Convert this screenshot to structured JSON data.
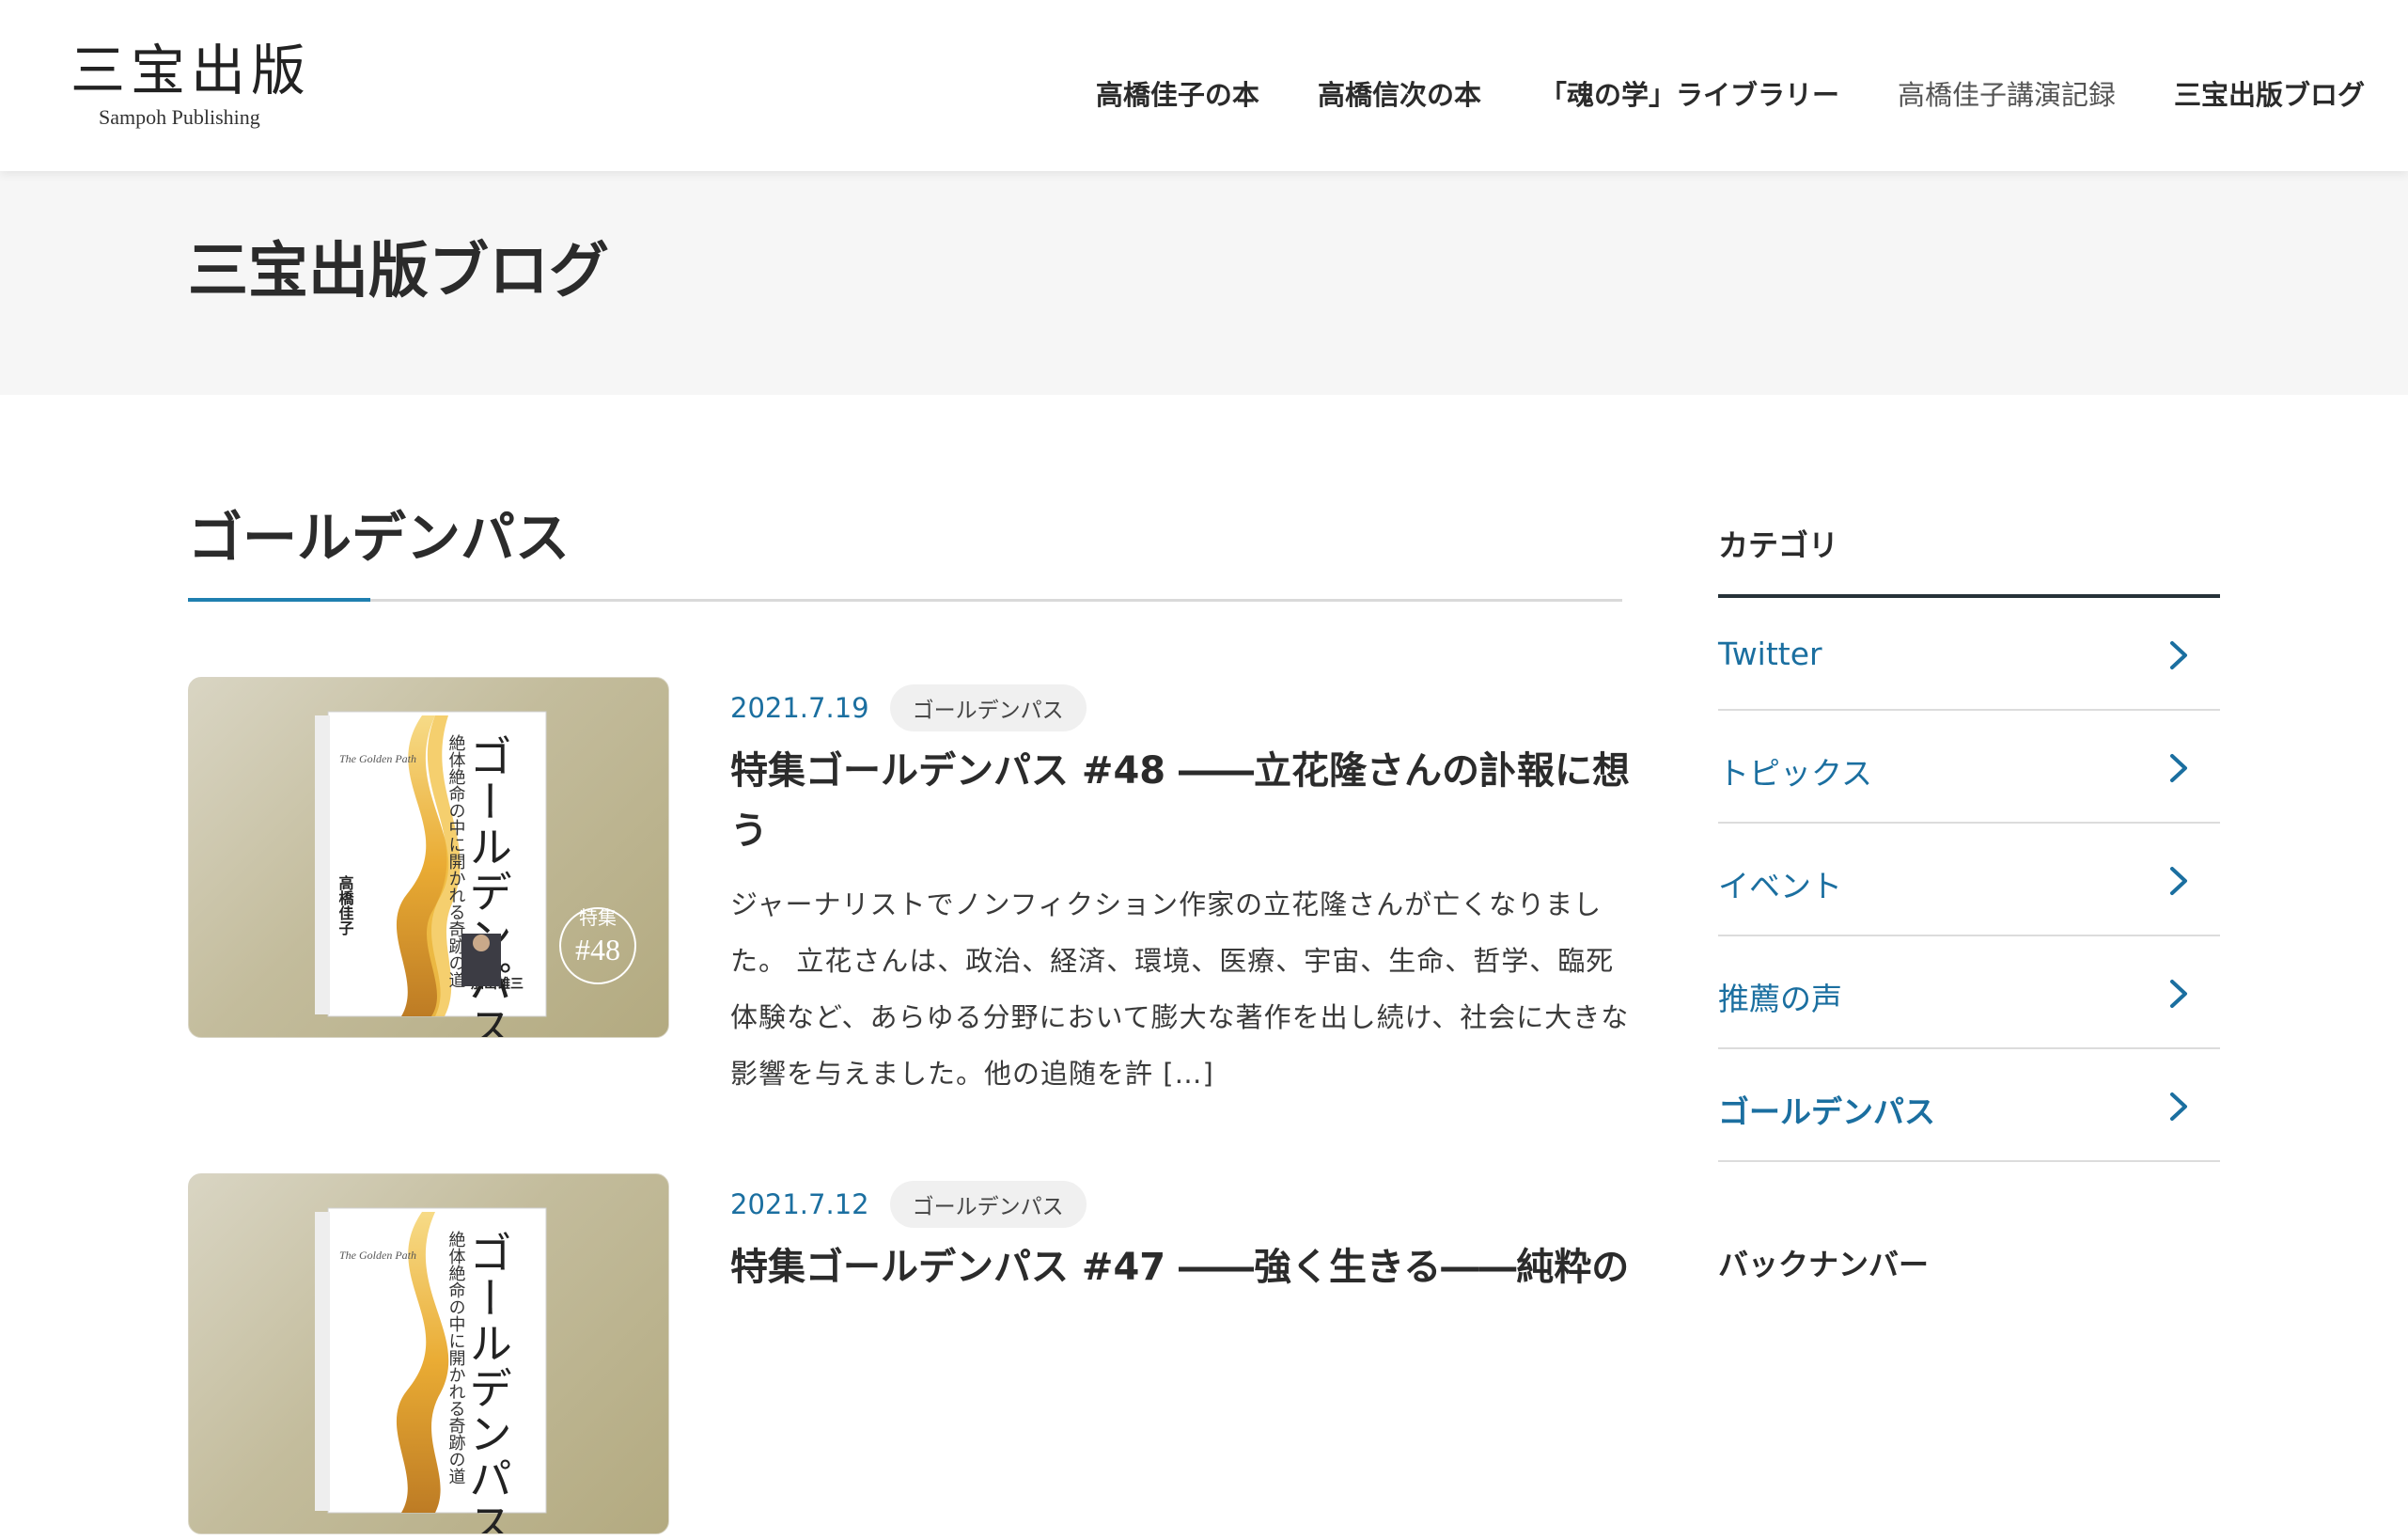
{
  "header": {
    "logo_jp": "三宝出版",
    "logo_en": "Sampoh Publishing",
    "nav": [
      "高橋佳子の本",
      "高橋信次の本",
      "「魂の学」ライブラリー",
      "高橋佳子講演記録",
      "三宝出版ブログ"
    ]
  },
  "page": {
    "title": "三宝出版ブログ"
  },
  "main": {
    "section_title": "ゴールデンパス",
    "posts": [
      {
        "date": "2021.7.19",
        "category": "ゴールデンパス",
        "title": "特集ゴールデンパス #48 ――立花隆さんの訃報に想う",
        "excerpt": "ジャーナリストでノンフィクション作家の立花隆さんが亡くなりました。 立花さんは、政治、経済、環境、医療、宇宙、生命、哲学、臨死体験など、あらゆる分野において膨大な著作を出し続け、社会に大きな影響を与えました。他の追随を許 […]",
        "thumb": {
          "book_title": "ゴールデンパス",
          "book_subtitle": "絶体絶命の中に開かれる奇跡の道",
          "book_en": "The Golden Path",
          "author": "高橋佳子",
          "badge_label": "特集",
          "badge_number": "#48",
          "endorser": "加山雄三"
        }
      },
      {
        "date": "2021.7.12",
        "category": "ゴールデンパス",
        "title": "特集ゴールデンパス #47 ――強く生きる――純粋の",
        "thumb": {
          "book_title": "ゴールデンパス",
          "book_subtitle": "絶体絶命の中に開かれる奇跡の道",
          "book_en": "The Golden Path"
        }
      }
    ]
  },
  "sidebar": {
    "category_heading": "カテゴリ",
    "categories": [
      "Twitter",
      "トピックス",
      "イベント",
      "推薦の声",
      "ゴールデンパス"
    ],
    "active_category": "ゴールデンパス",
    "backnumber_heading": "バックナンバー"
  },
  "colors": {
    "accent_blue": "#1b6fa0",
    "title_band": "#f6f6f6"
  }
}
